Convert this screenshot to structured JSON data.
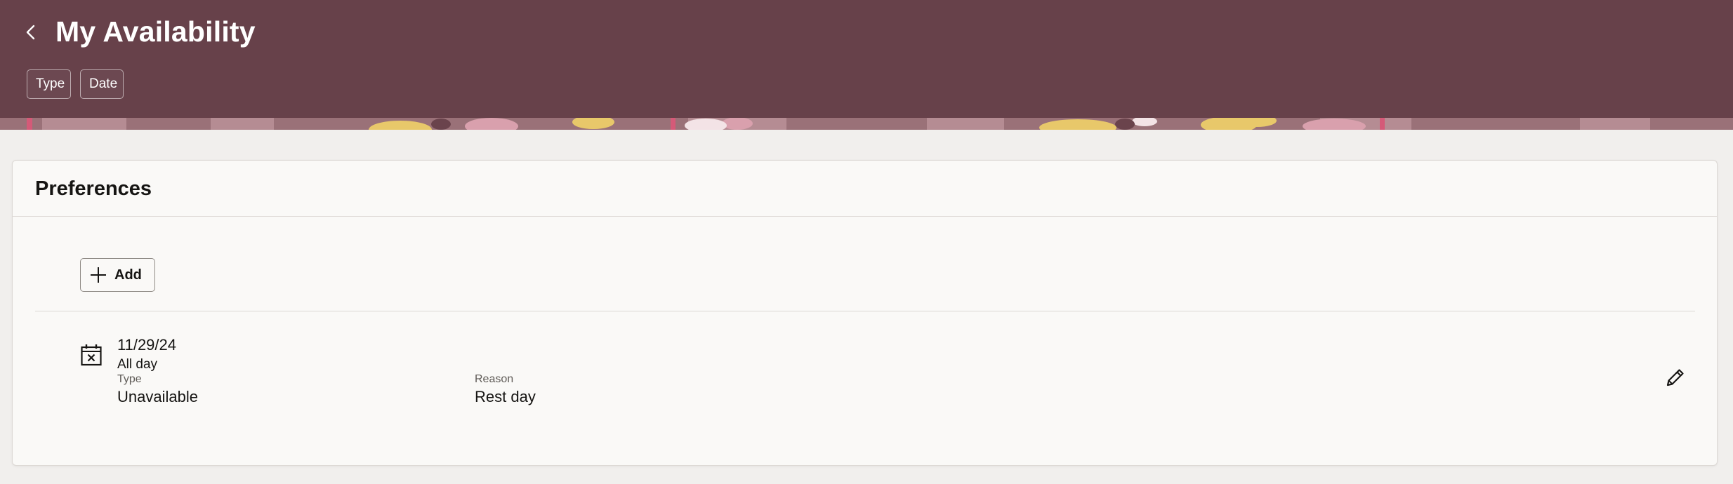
{
  "header": {
    "back_icon": "chevron-left-icon",
    "title": "My Availability",
    "filters": [
      {
        "label": "Type"
      },
      {
        "label": "Date"
      }
    ],
    "colors": {
      "background": "#67414a",
      "text": "#ffffff"
    }
  },
  "preferences": {
    "title": "Preferences",
    "add_button": {
      "icon": "plus-icon",
      "label": "Add"
    },
    "entries": [
      {
        "icon": "calendar-x-icon",
        "date": "11/29/24",
        "duration": "All day",
        "type_label": "Type",
        "type_value": "Unavailable",
        "reason_label": "Reason",
        "reason_value": "Rest day",
        "edit_icon": "pencil-icon"
      }
    ]
  }
}
